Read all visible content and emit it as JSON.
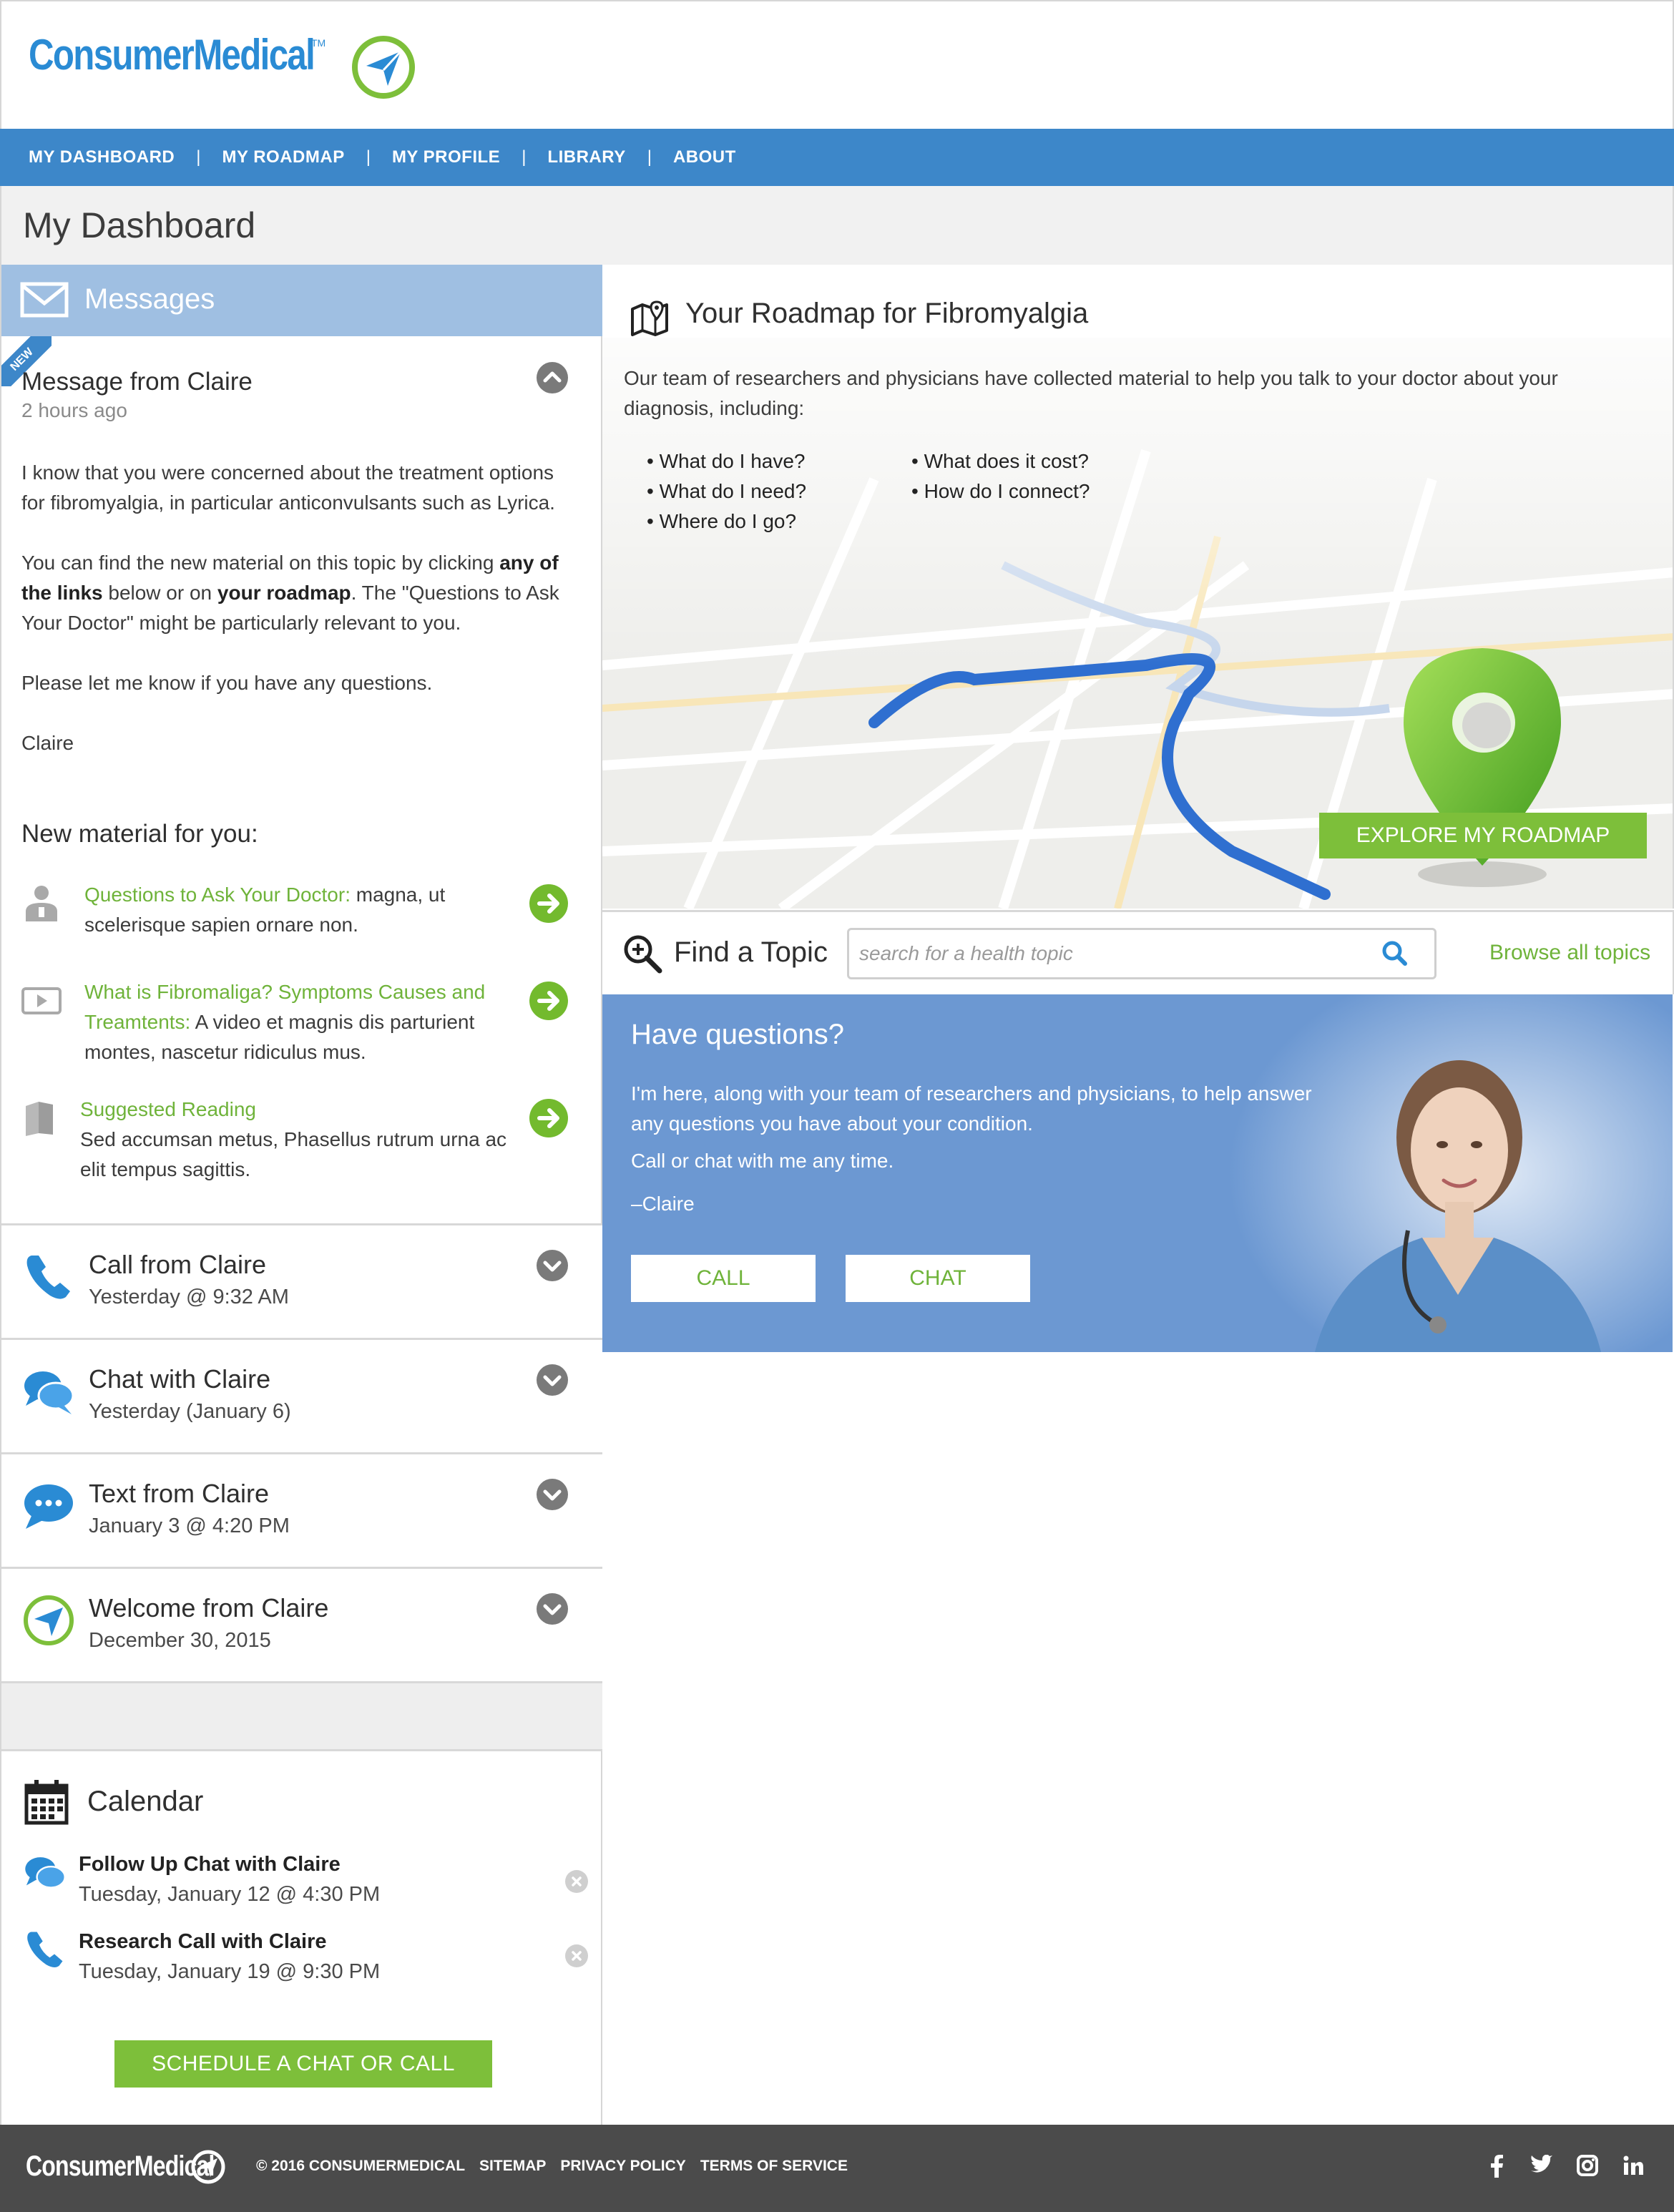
{
  "brand": {
    "logo_text": "ConsumerMedical",
    "tm": "TM"
  },
  "nav": {
    "items": [
      "MY DASHBOARD",
      "MY ROADMAP",
      "MY PROFILE",
      "LIBRARY",
      "ABOUT"
    ],
    "separator": "|"
  },
  "page": {
    "title": "My Dashboard"
  },
  "messages": {
    "header": "Messages",
    "ribbon": "NEW",
    "current": {
      "title": "Message from Claire",
      "time": "2 hours ago",
      "p1": "I know that you were concerned about the treatment options for fibromyalgia, in particular anticonvulsants such as Lyrica.",
      "p2_a": "You can find the new material on this topic by clicking ",
      "p2_b": "any of the links",
      "p2_c": " below or on ",
      "p2_d": "your roadmap",
      "p2_e": ". The \"Questions to Ask Your Doctor\" might be particularly relevant to you.",
      "p3": "Please let me know if you have any questions.",
      "p4": "Claire"
    },
    "new_material_title": "New material for you:",
    "materials": [
      {
        "link": "Questions to Ask Your Doctor:",
        "text": " magna, ut scelerisque sapien ornare non."
      },
      {
        "link": "What is Fibromaliga? Symptoms Causes and Treamtents:",
        "text": " A video et magnis dis parturient montes, nascetur ridiculus mus."
      },
      {
        "link": "Suggested Reading",
        "text": "Sed accumsan metus, Phasellus rutrum urna ac elit tempus sagittis."
      }
    ],
    "history": [
      {
        "title": "Call from Claire",
        "sub": "Yesterday @ 9:32 AM",
        "icon": "phone-icon"
      },
      {
        "title": "Chat with Claire",
        "sub": "Yesterday (January 6)",
        "icon": "chat-bubbles-icon"
      },
      {
        "title": "Text from Claire",
        "sub": "January 3 @ 4:20 PM",
        "icon": "text-bubble-icon"
      },
      {
        "title": "Welcome from Claire",
        "sub": "December 30, 2015",
        "icon": "logo-compass-icon"
      }
    ]
  },
  "calendar": {
    "title": "Calendar",
    "events": [
      {
        "title": "Follow Up Chat with Claire",
        "when": "Tuesday, January 12 @ 4:30 PM"
      },
      {
        "title": "Research Call with Claire",
        "when": "Tuesday, January 19 @ 9:30 PM"
      }
    ],
    "schedule_button": "SCHEDULE A CHAT OR CALL"
  },
  "roadmap": {
    "title": "Your Roadmap for Fibromyalgia",
    "description": "Our team of researchers and physicians have collected material to help you talk to your doctor about your diagnosis, including:",
    "bullets": [
      "• What do I have?",
      "• What does it cost?",
      "• What do I need?",
      "• How do I connect?",
      "• Where do I go?"
    ],
    "explore_button": "EXPLORE MY ROADMAP"
  },
  "find_topic": {
    "label": "Find a Topic",
    "placeholder": "search for a health topic",
    "browse_link": "Browse all topics"
  },
  "questions": {
    "title": "Have questions?",
    "p1": "I'm here, along with your team of researchers and physicians, to help answer any questions you have about your condition.",
    "p2": "Call or chat with me any time.",
    "p3": "–Claire",
    "call_button": "CALL",
    "chat_button": "CHAT"
  },
  "footer": {
    "logo_text": "ConsumerMedical",
    "links": [
      "© 2016 CONSUMERMEDICAL",
      "SITEMAP",
      "PRIVACY POLICY",
      "TERMS OF SERVICE"
    ],
    "social": [
      "f",
      "t",
      "ig",
      "in"
    ]
  },
  "colors": {
    "nav_blue": "#3d87c9",
    "messages_header": "#9fbfe2",
    "accent_green": "#7dbf3a",
    "questions_bg": "#6c98d2",
    "footer_bg": "#4b4b4b"
  }
}
